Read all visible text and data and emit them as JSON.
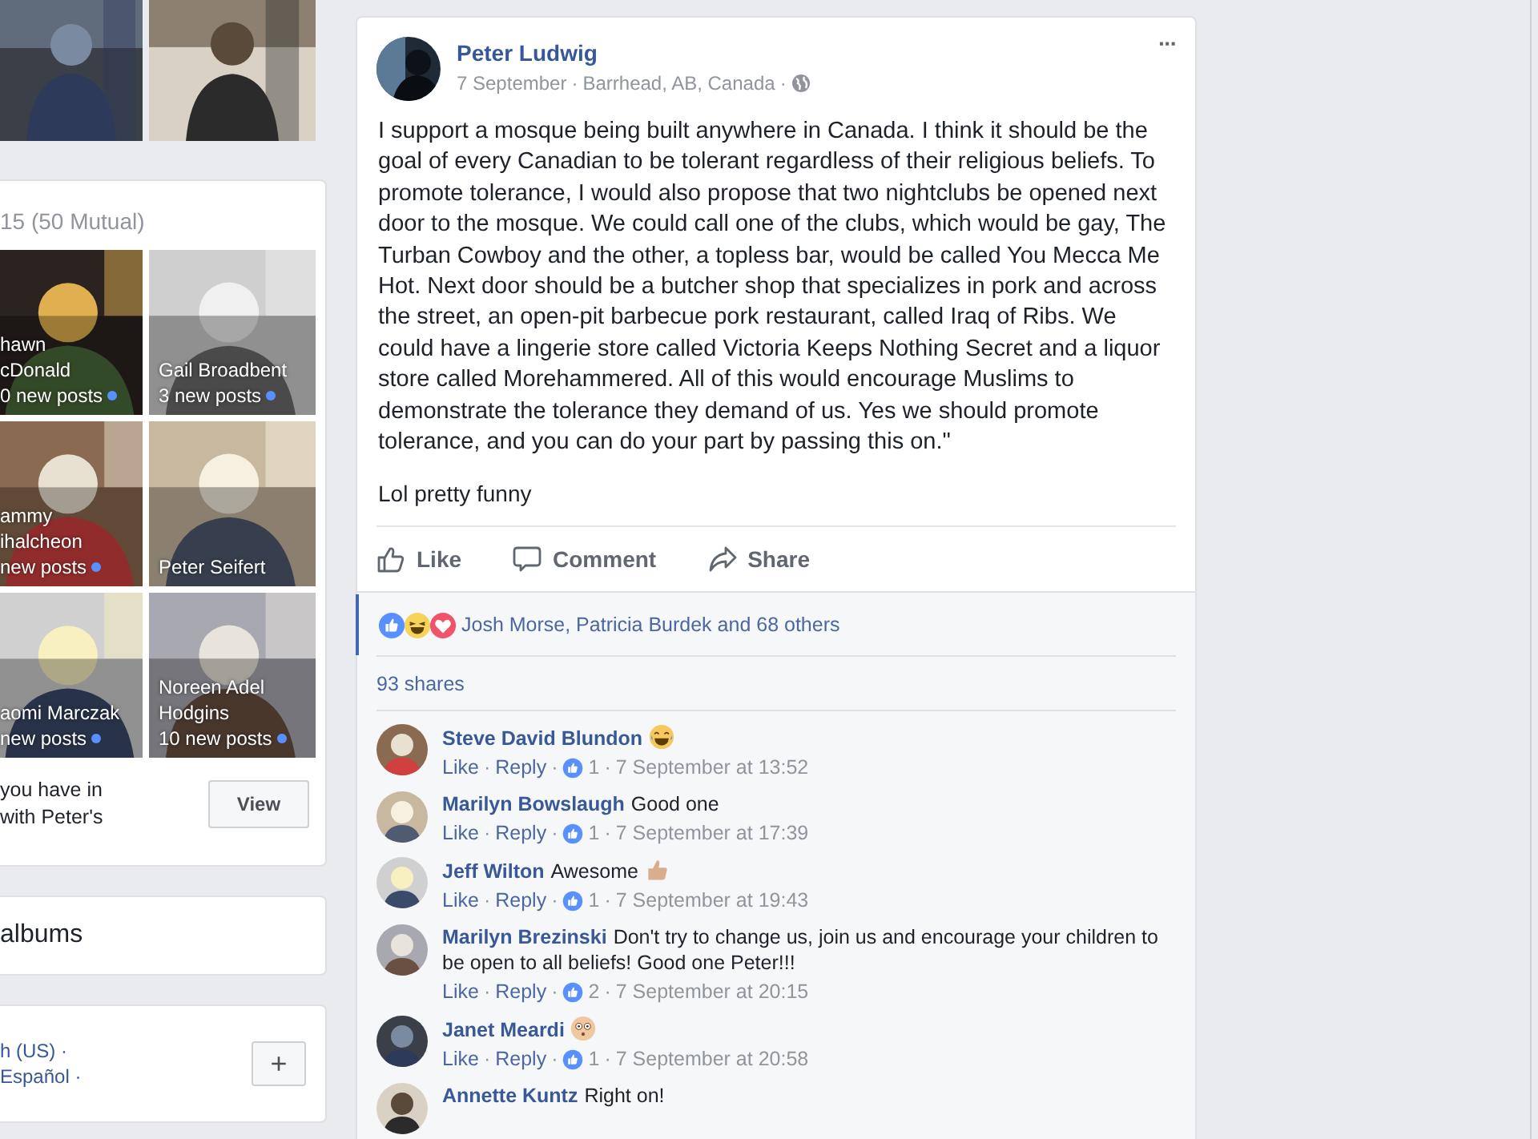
{
  "left": {
    "friends": {
      "heading": "15 (50 Mutual)",
      "tiles": [
        {
          "name": "hawn\ncDonald",
          "posts": "0 new posts"
        },
        {
          "name": "Gail Broadbent",
          "posts": "3 new posts"
        },
        {
          "name": "ammy\nihalcheon",
          "posts": "new posts"
        },
        {
          "name": "Peter Seifert"
        },
        {
          "name": "aomi Marczak",
          "posts": "new posts"
        },
        {
          "name": "Noreen Adel\nHodgins",
          "posts": "10 new posts"
        }
      ],
      "note": "you have in\nwith Peter's",
      "button": "View"
    },
    "albums": "albums",
    "footer": {
      "languages": [
        "h (US) ·",
        "Español ·"
      ],
      "button": "+"
    }
  },
  "post": {
    "author": "Peter Ludwig",
    "date": "7 September",
    "sep": "·",
    "location": "Barrhead, AB, Canada",
    "menu": "···",
    "body": "I support a mosque being built anywhere in Canada. I think it should be the goal of every Canadian to be tolerant regardless of their religious beliefs. To promote tolerance, I would also propose that two nightclubs be opened next door to the mosque. We could call one of the clubs, which would be gay, The Turban Cowboy and the other, a topless bar, would be called You Mecca Me Hot. Next door should be a butcher shop that specializes in pork and across the street, an open-pit barbecue pork restaurant, called Iraq of Ribs. We could have a lingerie store called Victoria Keeps Nothing Secret and a liquor store called Morehammered. All of this would encourage Muslims to demonstrate the tolerance they demand of us. Yes we should promote tolerance, and you can do your part by passing this on.\"",
    "caption": "Lol pretty funny",
    "actions": [
      {
        "kind": "like",
        "label": "Like"
      },
      {
        "kind": "comment",
        "label": "Comment"
      },
      {
        "kind": "share",
        "label": "Share"
      }
    ],
    "reactions": {
      "icons": [
        {
          "kind": "like"
        },
        {
          "kind": "haha"
        },
        {
          "kind": "love"
        }
      ],
      "text": "Josh Morse, Patricia Burdek and 68 others"
    },
    "shares": "93 shares",
    "comments": [
      {
        "name": "Steve David Blundon",
        "emoji": {
          "kind": "laughing"
        },
        "like": "Like",
        "reply": "Reply",
        "count": "1",
        "time": "7 September at 13:52"
      },
      {
        "name": "Marilyn Bowslaugh",
        "text": "Good one",
        "like": "Like",
        "reply": "Reply",
        "count": "1",
        "time": "7 September at 17:39"
      },
      {
        "name": "Jeff Wilton",
        "text": "Awesome",
        "emoji": {
          "kind": "thumbs"
        },
        "like": "Like",
        "reply": "Reply",
        "count": "1",
        "time": "7 September at 19:43"
      },
      {
        "name": "Marilyn Brezinski",
        "text": "Don't try to change us, join us and encourage your children to be open to all beliefs! Good one Peter!!!",
        "like": "Like",
        "reply": "Reply",
        "count": "2",
        "time": "7 September at 20:15"
      },
      {
        "name": "Janet Meardi",
        "emoji": {
          "kind": "astonished"
        },
        "like": "Like",
        "reply": "Reply",
        "count": "1",
        "time": "7 September at 20:58"
      },
      {
        "name": "Annette Kuntz",
        "text": "Right on!"
      }
    ]
  }
}
